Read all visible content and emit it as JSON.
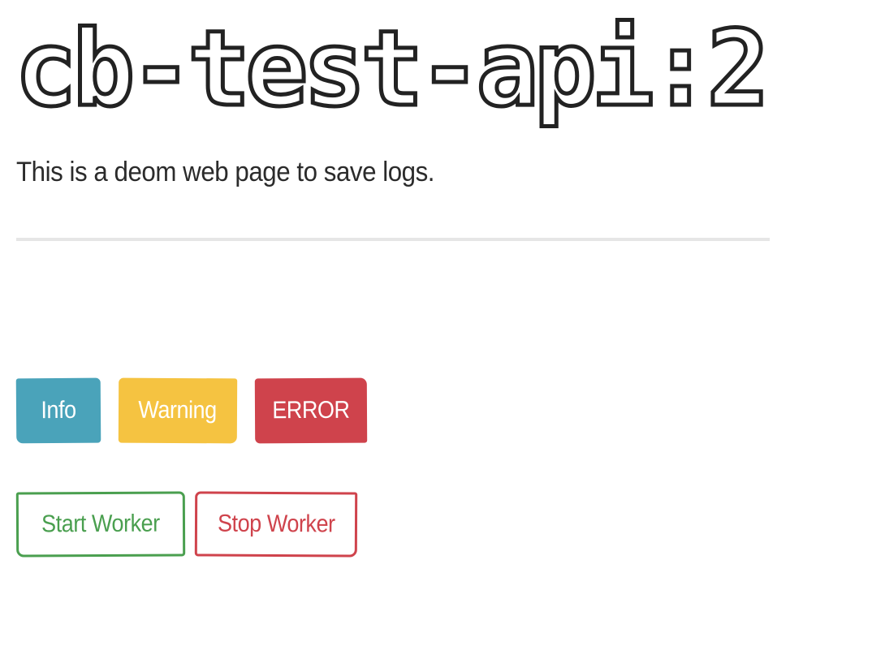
{
  "header": {
    "title": "cb-test-api:2",
    "subtitle": "This is a deom web page to save logs."
  },
  "log_buttons": {
    "info_label": "Info",
    "warning_label": "Warning",
    "error_label": "ERROR"
  },
  "worker_buttons": {
    "start_label": "Start Worker",
    "stop_label": "Stop Worker"
  },
  "colors": {
    "info": "#4aa3ba",
    "warning": "#f5c341",
    "error": "#cf434c",
    "success": "#4a9f4f",
    "text": "#2b2b2b",
    "divider": "#e6e6e6"
  }
}
